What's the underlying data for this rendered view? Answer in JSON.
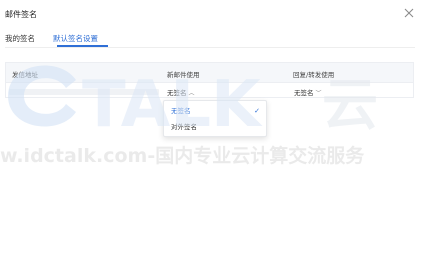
{
  "dialog": {
    "title": "邮件签名"
  },
  "tabs": [
    {
      "label": "我的签名",
      "active": false
    },
    {
      "label": "默认签名设置",
      "active": true
    }
  ],
  "table": {
    "headers": [
      "发信地址",
      "新邮件使用",
      "回复/转发使用"
    ],
    "row": {
      "new_mail_value": "无签名",
      "reply_value": "无签名"
    }
  },
  "dropdown": {
    "options": [
      {
        "label": "无签名",
        "selected": true
      },
      {
        "label": "对外签名",
        "selected": false
      }
    ]
  },
  "watermark": {
    "logo_text": "TALK",
    "logo_suffix": "云",
    "url_text": "w.idctalk.com-国内专业云计算交流服务"
  },
  "colors": {
    "accent": "#2f6fd6",
    "header_bg": "#f5f7fa",
    "watermark": "#d9e4f3"
  },
  "icons": {
    "close": "close-icon",
    "chevron": "chevron-down-icon",
    "check": "check-icon"
  }
}
